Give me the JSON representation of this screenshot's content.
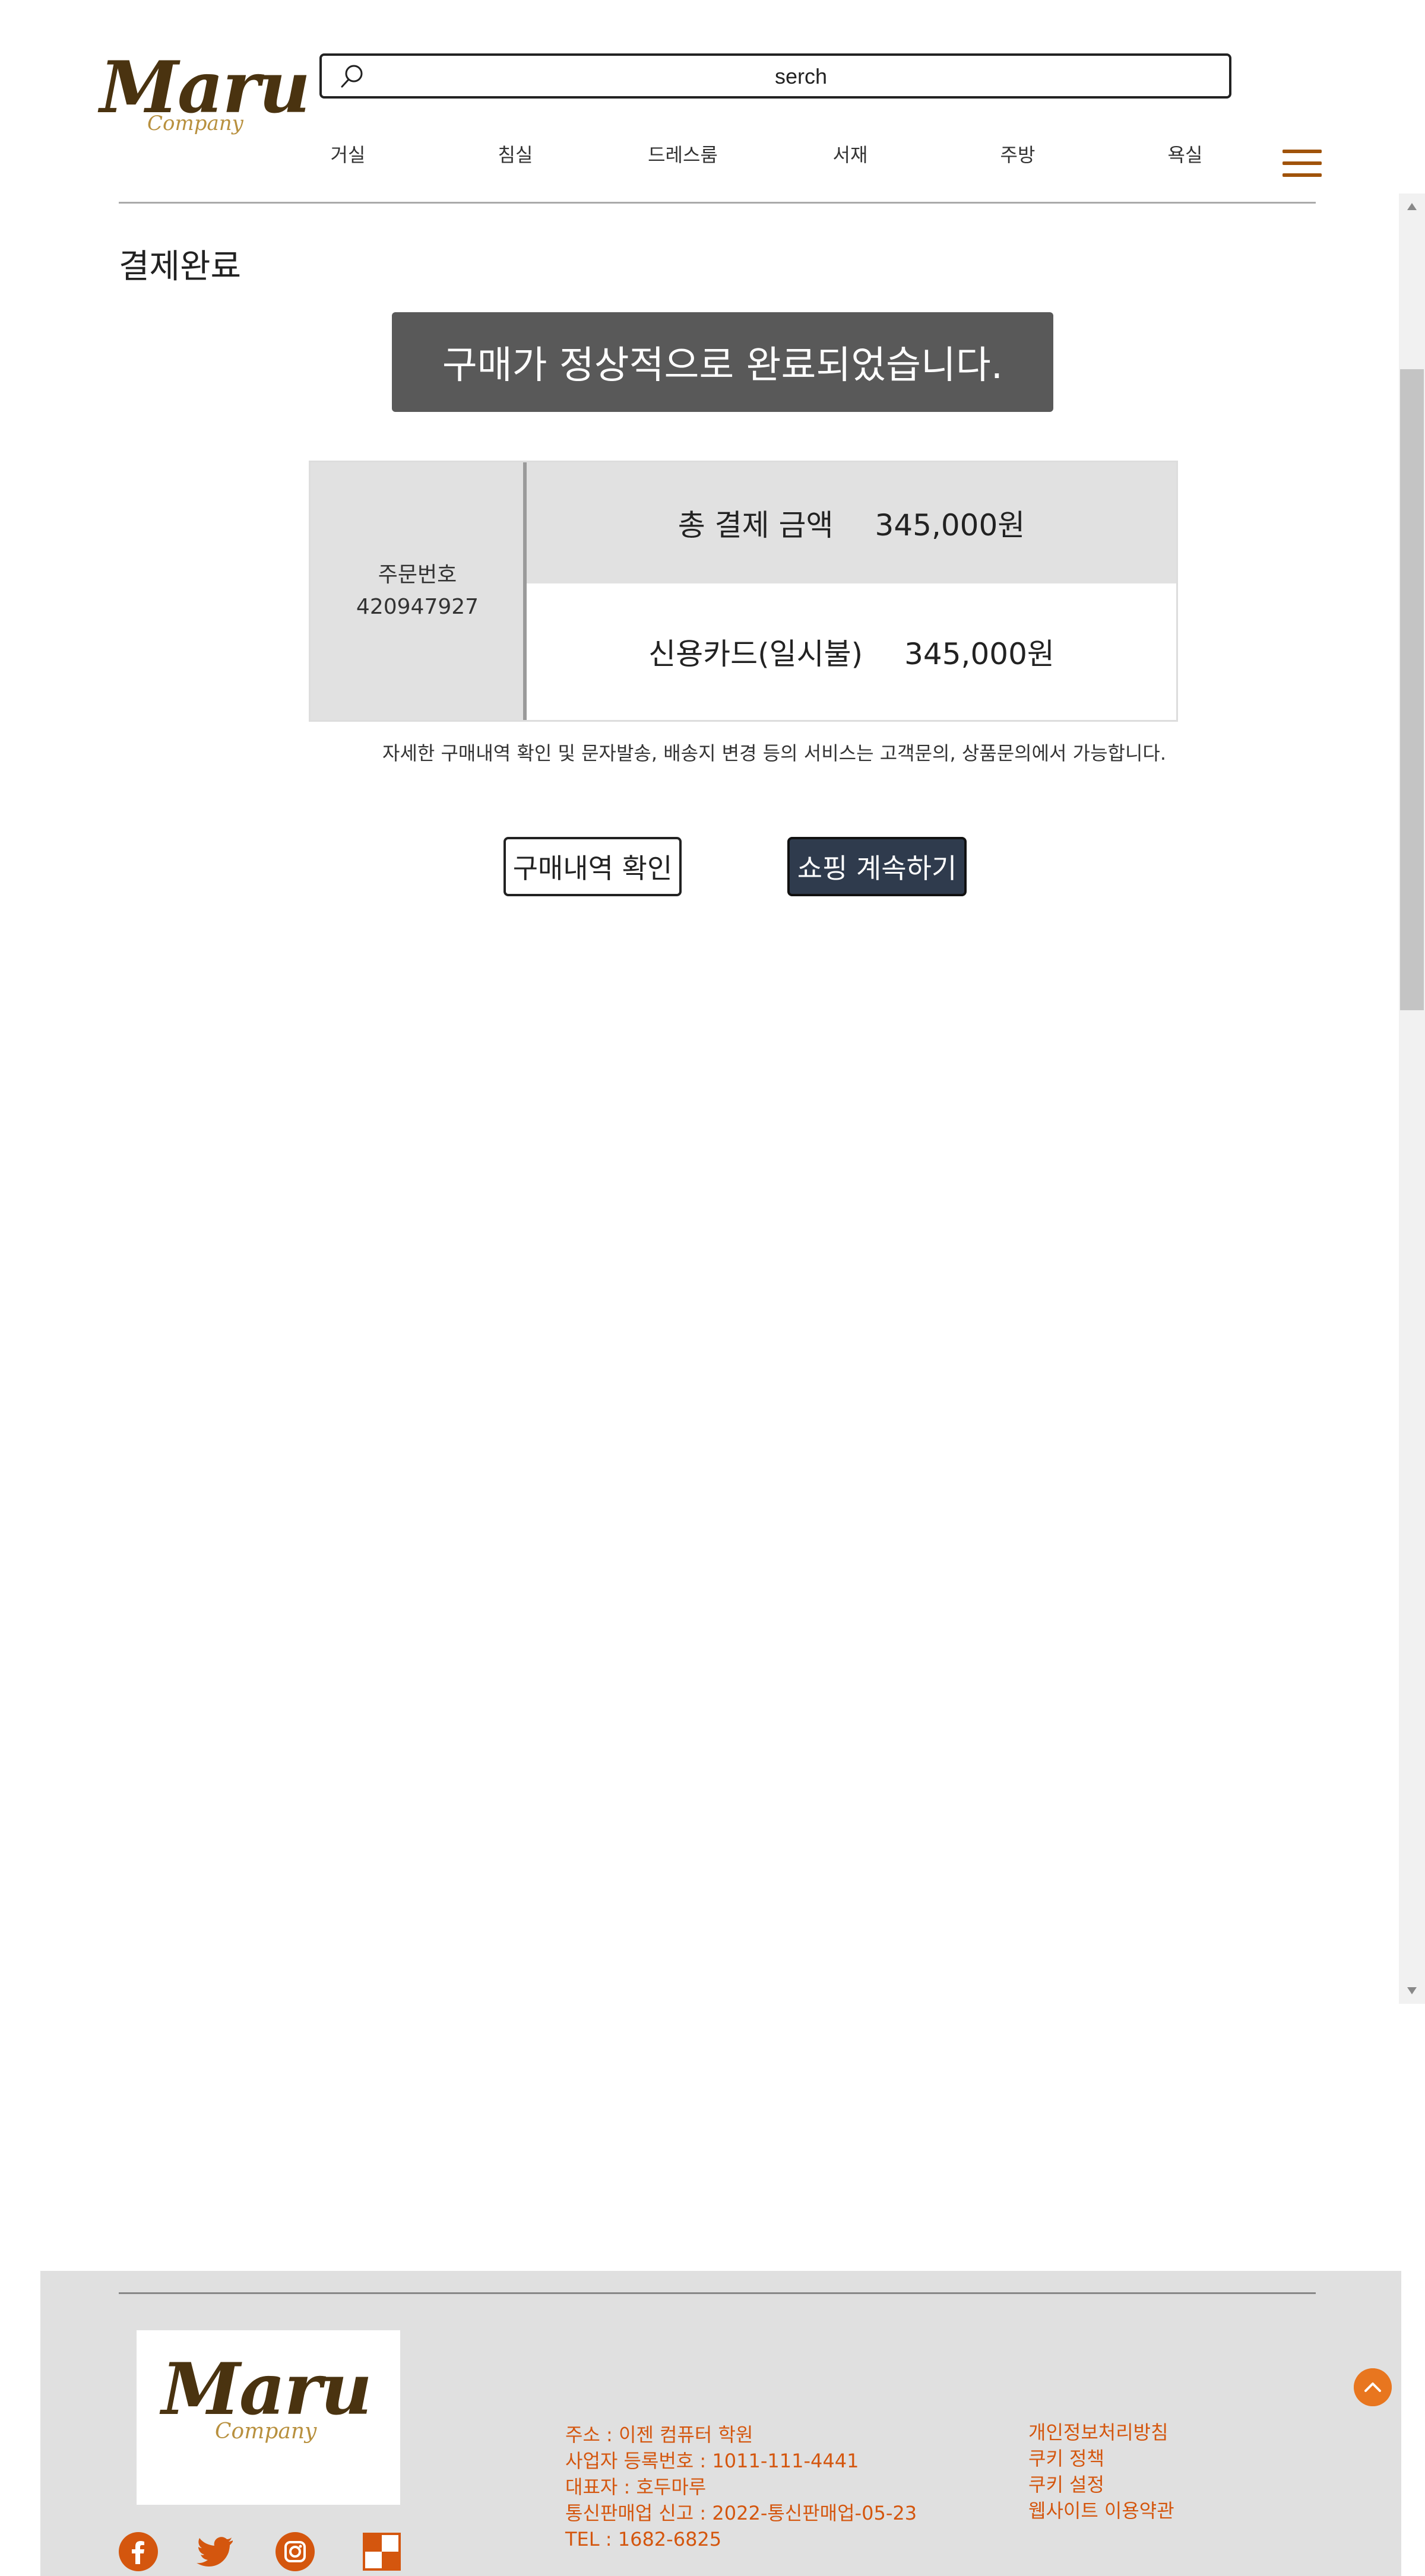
{
  "header": {
    "logo_text": "Maru",
    "logo_sub": "Company",
    "search_placeholder": "serch",
    "nav": [
      {
        "label": "거실"
      },
      {
        "label": "침실"
      },
      {
        "label": "드레스룸"
      },
      {
        "label": "서재"
      },
      {
        "label": "주방"
      },
      {
        "label": "욕실"
      }
    ],
    "menu_icon": "hamburger-icon",
    "accent_color": "#a0530a"
  },
  "main": {
    "page_title": "결제완료",
    "success_message": "구매가 정상적으로 완료되었습니다.",
    "order": {
      "order_number_label": "주문번호",
      "order_number": "420947927",
      "total_label": "총 결제 금액",
      "total_amount": "345,000원",
      "payment_method": "신용카드(일시불)",
      "payment_amount": "345,000원"
    },
    "notice": "자세한 구매내역 확인 및 문자발송, 배송지 변경 등의 서비스는 고객문의, 상품문의에서 가능합니다.",
    "buttons": {
      "history": "구매내역 확인",
      "continue": "쇼핑 계속하기"
    }
  },
  "footer": {
    "logo_text": "Maru",
    "logo_sub": "Company",
    "info": [
      "주소 : 이젠 컴퓨터 학원",
      "사업자 등록번호 : 1011-111-4441",
      "대표자 : 호두마루",
      "통신판매업 신고 : 2022-통신판매업-05-23",
      "TEL : 1682-6825"
    ],
    "links": [
      "개인정보처리방침",
      "쿠키 정책",
      "쿠키 설정",
      "웹사이트 이용약관"
    ],
    "social_icons": [
      "facebook-icon",
      "twitter-icon",
      "instagram-icon",
      "checker-icon"
    ],
    "link_color": "#d4560e",
    "to_top_icon": "chevron-up-icon"
  }
}
